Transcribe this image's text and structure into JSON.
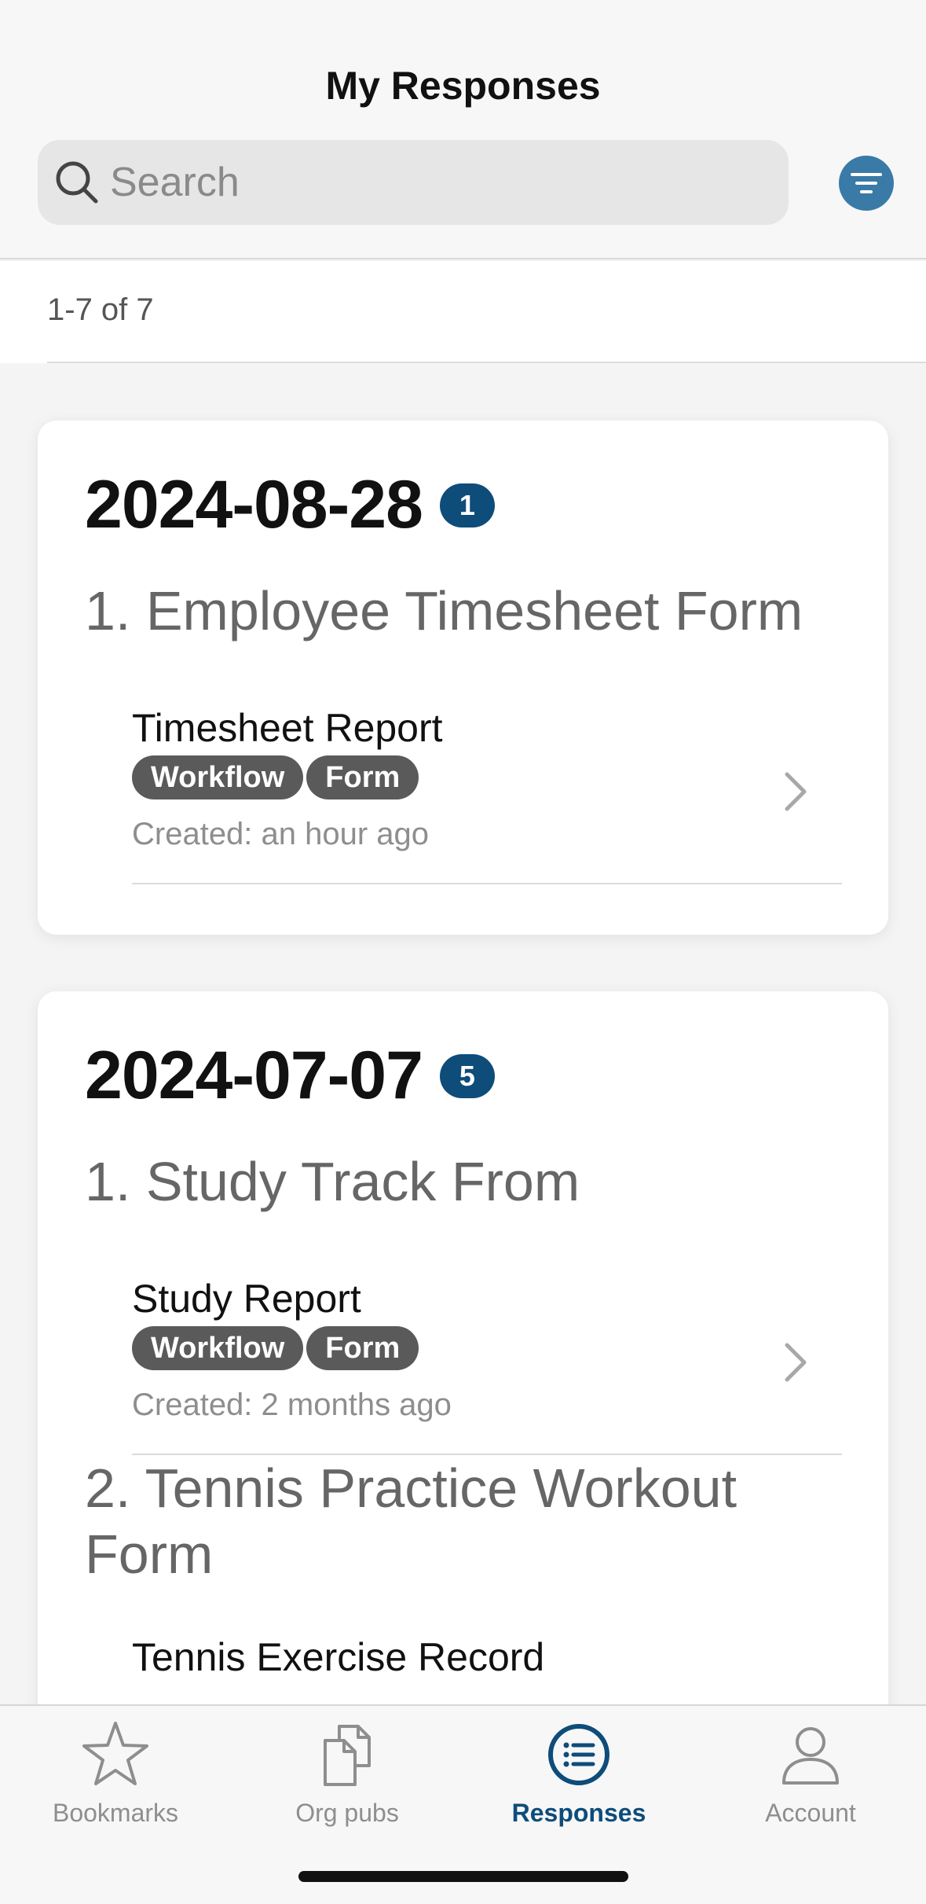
{
  "header": {
    "title": "My Responses",
    "search_placeholder": "Search"
  },
  "results": {
    "count_text": "1-7 of 7"
  },
  "groups": [
    {
      "date": "2024-08-28",
      "count": "1",
      "forms": [
        {
          "title": "1. Employee Timesheet Form",
          "responses": [
            {
              "name": "Timesheet Report",
              "tags": [
                "Workflow",
                "Form"
              ],
              "created": "Created: an hour ago"
            }
          ]
        }
      ]
    },
    {
      "date": "2024-07-07",
      "count": "5",
      "forms": [
        {
          "title": "1. Study Track From",
          "responses": [
            {
              "name": "Study Report",
              "tags": [
                "Workflow",
                "Form"
              ],
              "created": "Created: 2 months ago"
            }
          ]
        },
        {
          "title": "2. Tennis Practice Workout Form",
          "responses": [
            {
              "name": "Tennis Exercise Record"
            }
          ]
        }
      ]
    }
  ],
  "tabbar": {
    "tabs": [
      {
        "label": "Bookmarks",
        "icon": "star-icon"
      },
      {
        "label": "Org pubs",
        "icon": "documents-icon"
      },
      {
        "label": "Responses",
        "icon": "list-icon",
        "active": true
      },
      {
        "label": "Account",
        "icon": "person-icon"
      }
    ]
  },
  "colors": {
    "accent": "#0e4c7a",
    "filter_button": "#3a7aa6",
    "tag_background": "#5a5a5a"
  }
}
